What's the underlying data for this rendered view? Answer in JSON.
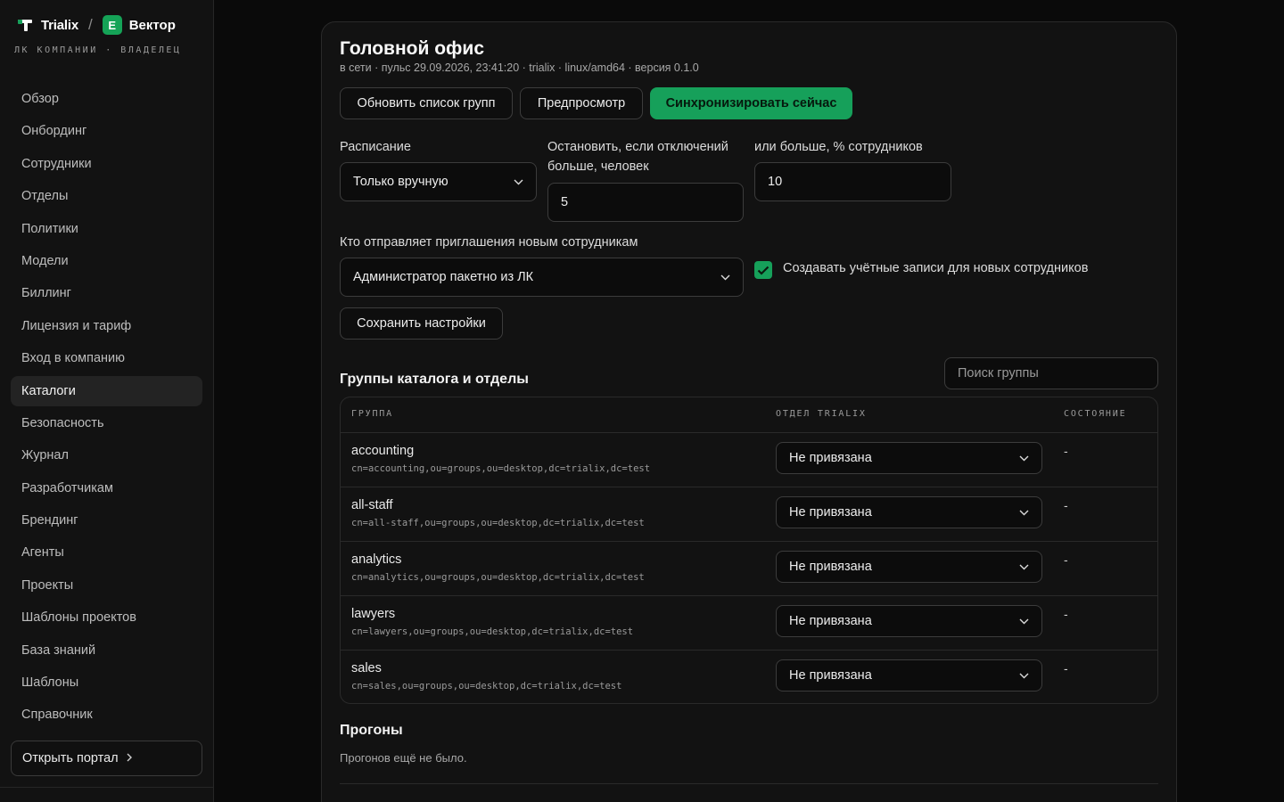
{
  "brand": {
    "name": "Trialix",
    "separator": "/",
    "company_initial": "E",
    "company_name": "Вектор",
    "subtitle": "ЛК КОМПАНИИ · ВЛАДЕЛЕЦ",
    "accent": "#16a05a"
  },
  "sidebar": {
    "items": [
      {
        "label": "Обзор"
      },
      {
        "label": "Онбординг"
      },
      {
        "label": "Сотрудники"
      },
      {
        "label": "Отделы"
      },
      {
        "label": "Политики"
      },
      {
        "label": "Модели"
      },
      {
        "label": "Биллинг"
      },
      {
        "label": "Лицензия и тариф"
      },
      {
        "label": "Вход в компанию"
      },
      {
        "label": "Каталоги",
        "active": true
      },
      {
        "label": "Безопасность"
      },
      {
        "label": "Журнал"
      },
      {
        "label": "Разработчикам"
      },
      {
        "label": "Брендинг"
      },
      {
        "label": "Агенты"
      },
      {
        "label": "Проекты"
      },
      {
        "label": "Шаблоны проектов"
      },
      {
        "label": "База знаний"
      },
      {
        "label": "Шаблоны"
      },
      {
        "label": "Справочник"
      }
    ],
    "portal_button": "Открыть портал"
  },
  "main": {
    "title": "Головной офис",
    "meta": "в сети · пульс 29.09.2026, 23:41:20 · trialix · linux/amd64 · версия 0.1.0",
    "buttons": {
      "refresh": "Обновить список групп",
      "preview": "Предпросмотр",
      "sync": "Синхронизировать сейчас",
      "save": "Сохранить настройки"
    },
    "schedule": {
      "label": "Расписание",
      "value": "Только вручную"
    },
    "stop_people": {
      "label": "Остановить, если отключений больше, человек",
      "value": "5"
    },
    "stop_percent": {
      "label": "или больше, % сотрудников",
      "value": "10"
    },
    "invites": {
      "label": "Кто отправляет приглашения новым сотрудникам",
      "value": "Администратор пакетно из ЛК"
    },
    "create_accounts": {
      "label": "Создавать учётные записи для новых сотрудников",
      "checked": true
    },
    "groups": {
      "title": "Группы каталога и отделы",
      "search_placeholder": "Поиск группы",
      "columns": [
        "ГРУППА",
        "ОТДЕЛ TRIALIX",
        "СОСТОЯНИЕ"
      ],
      "rows": [
        {
          "name": "accounting",
          "dn": "cn=accounting,ou=groups,ou=desktop,dc=trialix,dc=test",
          "department": "Не привязана",
          "state": "-"
        },
        {
          "name": "all-staff",
          "dn": "cn=all-staff,ou=groups,ou=desktop,dc=trialix,dc=test",
          "department": "Не привязана",
          "state": "-"
        },
        {
          "name": "analytics",
          "dn": "cn=analytics,ou=groups,ou=desktop,dc=trialix,dc=test",
          "department": "Не привязана",
          "state": "-"
        },
        {
          "name": "lawyers",
          "dn": "cn=lawyers,ou=groups,ou=desktop,dc=trialix,dc=test",
          "department": "Не привязана",
          "state": "-"
        },
        {
          "name": "sales",
          "dn": "cn=sales,ou=groups,ou=desktop,dc=trialix,dc=test",
          "department": "Не привязана",
          "state": "-"
        }
      ]
    },
    "runs": {
      "title": "Прогоны",
      "empty": "Прогонов ещё не было."
    }
  }
}
